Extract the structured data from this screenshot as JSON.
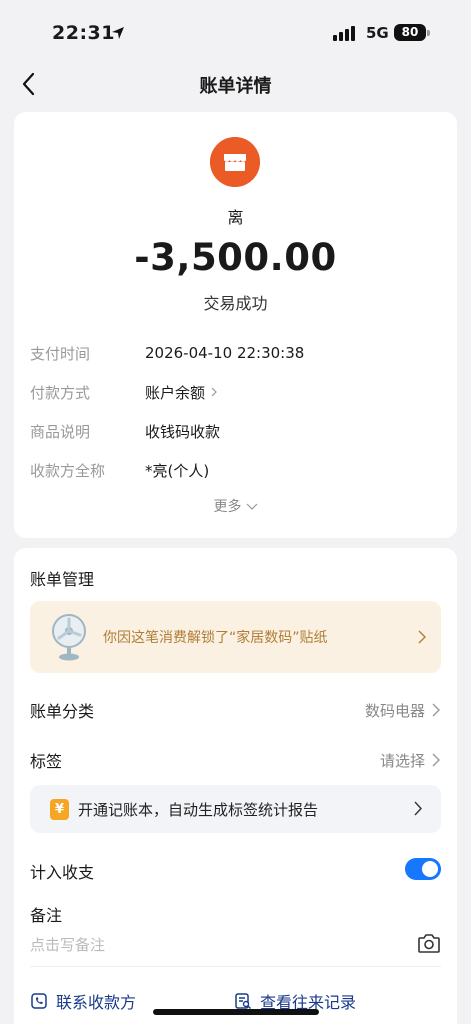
{
  "status_bar": {
    "time": "22:31",
    "network": "5G",
    "battery": "80"
  },
  "nav": {
    "title": "账单详情"
  },
  "transaction": {
    "merchant": "离",
    "amount": "-3,500.00",
    "status": "交易成功",
    "details": [
      {
        "label": "支付时间",
        "value": "2026-04-10 22:30:38"
      },
      {
        "label": "付款方式",
        "value": "账户余额"
      },
      {
        "label": "商品说明",
        "value": "收钱码收款"
      },
      {
        "label": "收款方全称",
        "value": "*亮(个人)"
      }
    ],
    "more": "更多"
  },
  "management": {
    "title": "账单管理",
    "sticker_banner": "你因这笔消费解锁了“家居数码”贴纸",
    "category": {
      "label": "账单分类",
      "value": "数码电器"
    },
    "tag": {
      "label": "标签",
      "value": "请选择"
    },
    "promo": {
      "icon_text": "¥",
      "text": "开通记账本，自动生成标签统计报告"
    },
    "include_toggle": {
      "label": "计入收支",
      "state": "on"
    },
    "note": {
      "label": "备注",
      "placeholder": "点击写备注"
    },
    "contact": "联系收款方",
    "history": "查看往来记录"
  },
  "colors": {
    "accent": "#1677ff",
    "merchant_icon": "#ea5b25",
    "banner_bg": "#fbf1e2",
    "banner_text": "#b07d37"
  }
}
